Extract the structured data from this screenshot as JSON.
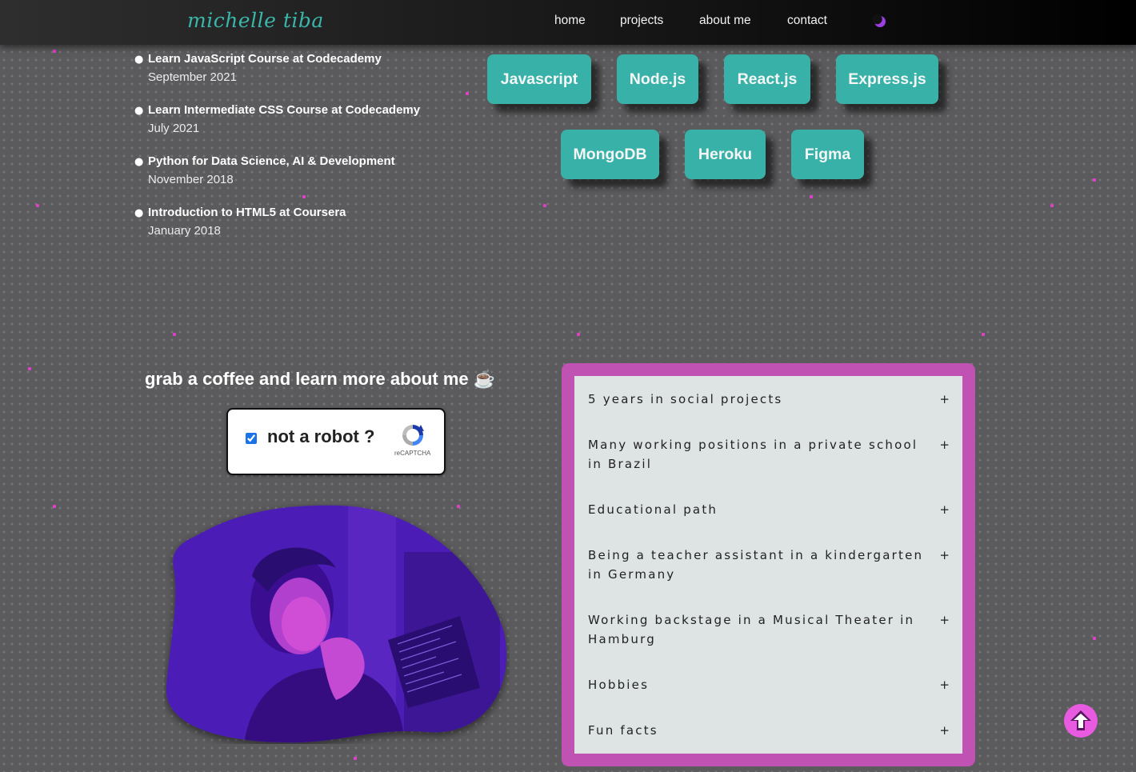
{
  "header": {
    "brand": "michelle tiba",
    "nav": [
      {
        "label": "home"
      },
      {
        "label": "projects"
      },
      {
        "label": "about me"
      },
      {
        "label": "contact"
      }
    ],
    "theme_toggle_icon": "moon-icon"
  },
  "courses": [
    {
      "title": "Learn JavaScript Course at Codecademy",
      "date": "September 2021"
    },
    {
      "title": "Learn Intermediate CSS Course at Codecademy",
      "date": "July 2021"
    },
    {
      "title": "Python for Data Science, AI & Development",
      "date": "November 2018"
    },
    {
      "title": "Introduction to HTML5 at Coursera",
      "date": "January 2018"
    }
  ],
  "skills": [
    "Javascript",
    "Node.js",
    "React.js",
    "Express.js",
    "MongoDB",
    "Heroku",
    "Figma"
  ],
  "coffee": {
    "title": "grab a coffee and learn more about me ☕",
    "captcha_label": "not a robot ?",
    "captcha_checked": true,
    "recaptcha_brand": "reCAPTCHA"
  },
  "accordion": {
    "items": [
      {
        "label": "5 years in social projects"
      },
      {
        "label": "Many working positions in a private school in Brazil"
      },
      {
        "label": "Educational path"
      },
      {
        "label": "Being a teacher assistant in a kindergarten in Germany"
      },
      {
        "label": "Working backstage in a Musical Theater in Hamburg"
      },
      {
        "label": "Hobbies"
      },
      {
        "label": "Fun facts"
      }
    ],
    "expand_symbol": "+"
  },
  "colors": {
    "accent_teal": "#38b2a8",
    "accent_pink": "#c052b4",
    "particle": "#e040c8",
    "background": "#5b5a5c"
  },
  "scroll_top_icon": "arrow-up-icon"
}
